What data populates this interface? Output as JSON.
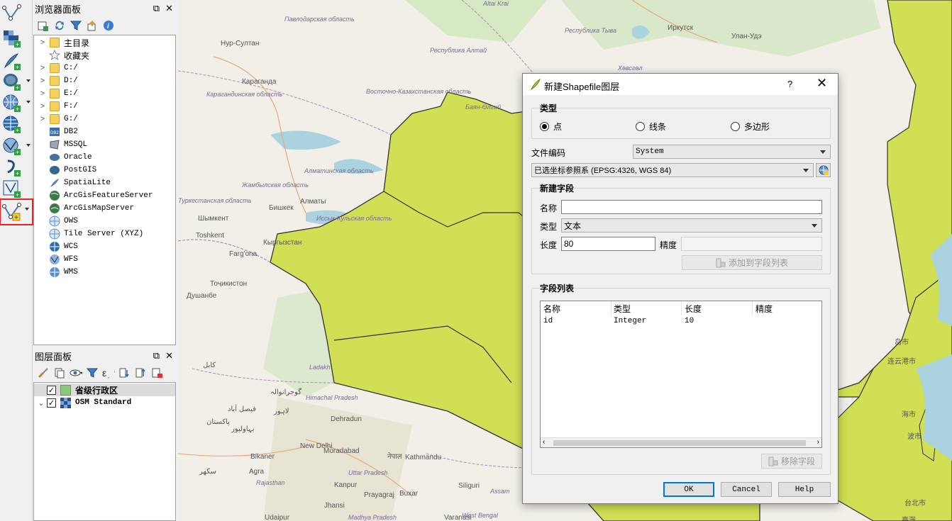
{
  "browser_panel": {
    "title": "浏览器面板",
    "ctrl_float": "⧉",
    "ctrl_close": "✕",
    "items": [
      {
        "label": "主目录",
        "arrow": ">",
        "icon": "folder-icon"
      },
      {
        "label": "收藏夹",
        "arrow": "",
        "icon": "star-icon"
      },
      {
        "label": "C:/",
        "arrow": ">",
        "icon": "folder-icon"
      },
      {
        "label": "D:/",
        "arrow": ">",
        "icon": "folder-icon"
      },
      {
        "label": "E:/",
        "arrow": ">",
        "icon": "folder-icon"
      },
      {
        "label": "F:/",
        "arrow": ">",
        "icon": "folder-icon"
      },
      {
        "label": "G:/",
        "arrow": ">",
        "icon": "folder-icon"
      },
      {
        "label": "DB2",
        "arrow": "",
        "icon": "db2-icon"
      },
      {
        "label": "MSSQL",
        "arrow": "",
        "icon": "mssql-icon"
      },
      {
        "label": "Oracle",
        "arrow": "",
        "icon": "oracle-icon"
      },
      {
        "label": "PostGIS",
        "arrow": "",
        "icon": "postgis-icon"
      },
      {
        "label": "SpatiaLite",
        "arrow": "",
        "icon": "spatialite-icon"
      },
      {
        "label": "ArcGisFeatureServer",
        "arrow": "",
        "icon": "arcgis-feature-icon"
      },
      {
        "label": "ArcGisMapServer",
        "arrow": "",
        "icon": "arcgis-map-icon"
      },
      {
        "label": "OWS",
        "arrow": "",
        "icon": "ows-icon"
      },
      {
        "label": "Tile Server (XYZ)",
        "arrow": "",
        "icon": "xyz-icon"
      },
      {
        "label": "WCS",
        "arrow": "",
        "icon": "wcs-icon"
      },
      {
        "label": "WFS",
        "arrow": "",
        "icon": "wfs-icon"
      },
      {
        "label": "WMS",
        "arrow": "",
        "icon": "wms-icon"
      }
    ]
  },
  "layers_panel": {
    "title": "图层面板",
    "ctrl_float": "⧉",
    "ctrl_close": "✕",
    "layers": [
      {
        "label": "省级行政区",
        "checked": true,
        "color": "#8dc87a",
        "arrow": ""
      },
      {
        "label": "OSM Standard",
        "checked": true,
        "color": "",
        "arrow": "⌄"
      }
    ]
  },
  "map": {
    "land_color": "#f2efe9",
    "polygon_color": "#d0df54",
    "labels": [
      {
        "text": "Altai Krai",
        "cls": "it"
      },
      {
        "text": "Нур-Султан",
        "cls": ""
      },
      {
        "text": "Павлодарская область",
        "cls": "it"
      },
      {
        "text": "Караганда",
        "cls": ""
      },
      {
        "text": "Карагандинская область",
        "cls": "it"
      },
      {
        "text": "Восточно-Казахстанская область",
        "cls": "it"
      },
      {
        "text": "Республика Алтай",
        "cls": "it"
      },
      {
        "text": "Республика Тыва",
        "cls": "it"
      },
      {
        "text": "Иркутск",
        "cls": ""
      },
      {
        "text": "Улан-Удэ",
        "cls": ""
      },
      {
        "text": "Алматинская область",
        "cls": "it"
      },
      {
        "text": "Жамбылская область",
        "cls": "it"
      },
      {
        "text": "Туркестанская область",
        "cls": "it"
      },
      {
        "text": "Бишкек",
        "cls": ""
      },
      {
        "text": "Алматы",
        "cls": ""
      },
      {
        "text": "Шымкент",
        "cls": ""
      },
      {
        "text": "Toshkent",
        "cls": ""
      },
      {
        "text": "Кыргызстан",
        "cls": ""
      },
      {
        "text": "Иссык-Кульская область",
        "cls": "it"
      },
      {
        "text": "Farg'ona",
        "cls": ""
      },
      {
        "text": "Тоҷикистон",
        "cls": ""
      },
      {
        "text": "Душанбе",
        "cls": ""
      },
      {
        "text": "Ladakh",
        "cls": "it"
      },
      {
        "text": "Himachal Pradesh",
        "cls": "it"
      },
      {
        "text": "Dehradun",
        "cls": ""
      },
      {
        "text": "New Delhi",
        "cls": ""
      },
      {
        "text": "Moradabad",
        "cls": ""
      },
      {
        "text": "Bikaner",
        "cls": ""
      },
      {
        "text": "Uttar Pradesh",
        "cls": "it"
      },
      {
        "text": "Agra",
        "cls": ""
      },
      {
        "text": "Kanpur",
        "cls": ""
      },
      {
        "text": "Rajasthan",
        "cls": "it"
      },
      {
        "text": "Jhansi",
        "cls": ""
      },
      {
        "text": "Prayagraj",
        "cls": ""
      },
      {
        "text": "Buxar",
        "cls": ""
      },
      {
        "text": "Kathmandu",
        "cls": ""
      },
      {
        "text": "Siliguri",
        "cls": ""
      },
      {
        "text": "Assam",
        "cls": "it"
      },
      {
        "text": "Udaipur",
        "cls": ""
      },
      {
        "text": "Madhya Pradesh",
        "cls": "it"
      },
      {
        "text": "Varanasi",
        "cls": ""
      },
      {
        "text": "West Bengal",
        "cls": "it"
      },
      {
        "text": "Хөвсгөл",
        "cls": "it"
      },
      {
        "text": "Баян-Өлгий",
        "cls": "it"
      },
      {
        "text": "پاکستان",
        "cls": ""
      },
      {
        "text": "کابل",
        "cls": ""
      },
      {
        "text": "لاہور",
        "cls": ""
      },
      {
        "text": "گوجرانوالہ",
        "cls": ""
      },
      {
        "text": "فیصل آباد",
        "cls": ""
      },
      {
        "text": "بہاولپور",
        "cls": ""
      },
      {
        "text": "سکھر",
        "cls": ""
      },
      {
        "text": "नेपाल",
        "cls": ""
      },
      {
        "text": "岛市",
        "cls": ""
      },
      {
        "text": "连云港市",
        "cls": ""
      },
      {
        "text": "海市",
        "cls": ""
      },
      {
        "text": "波市",
        "cls": ""
      },
      {
        "text": "台北市",
        "cls": ""
      },
      {
        "text": "臺灣",
        "cls": ""
      }
    ]
  },
  "dialog": {
    "title": "新建Shapefile图层",
    "help": "?",
    "close": "✕",
    "type_group": "类型",
    "type_point": "点",
    "type_line": "线条",
    "type_polygon": "多边形",
    "type_selected": "点",
    "encoding_label": "文件编码",
    "encoding_value": "System",
    "crs_value": "已选坐标参照系 (EPSG:4326, WGS 84)",
    "new_field_group": "新建字段",
    "name_label": "名称",
    "name_value": "",
    "ftype_label": "类型",
    "ftype_value": "文本",
    "length_label": "长度",
    "length_value": "80",
    "precision_label": "精度",
    "precision_value": "",
    "add_field_btn": "添加到字段列表",
    "field_list_group": "字段列表",
    "columns": [
      "名称",
      "类型",
      "长度",
      "精度"
    ],
    "rows": [
      [
        "id",
        "Integer",
        "10",
        ""
      ]
    ],
    "remove_field_btn": "移除字段",
    "ok": "OK",
    "cancel": "Cancel",
    "helpbtn": "Help"
  }
}
